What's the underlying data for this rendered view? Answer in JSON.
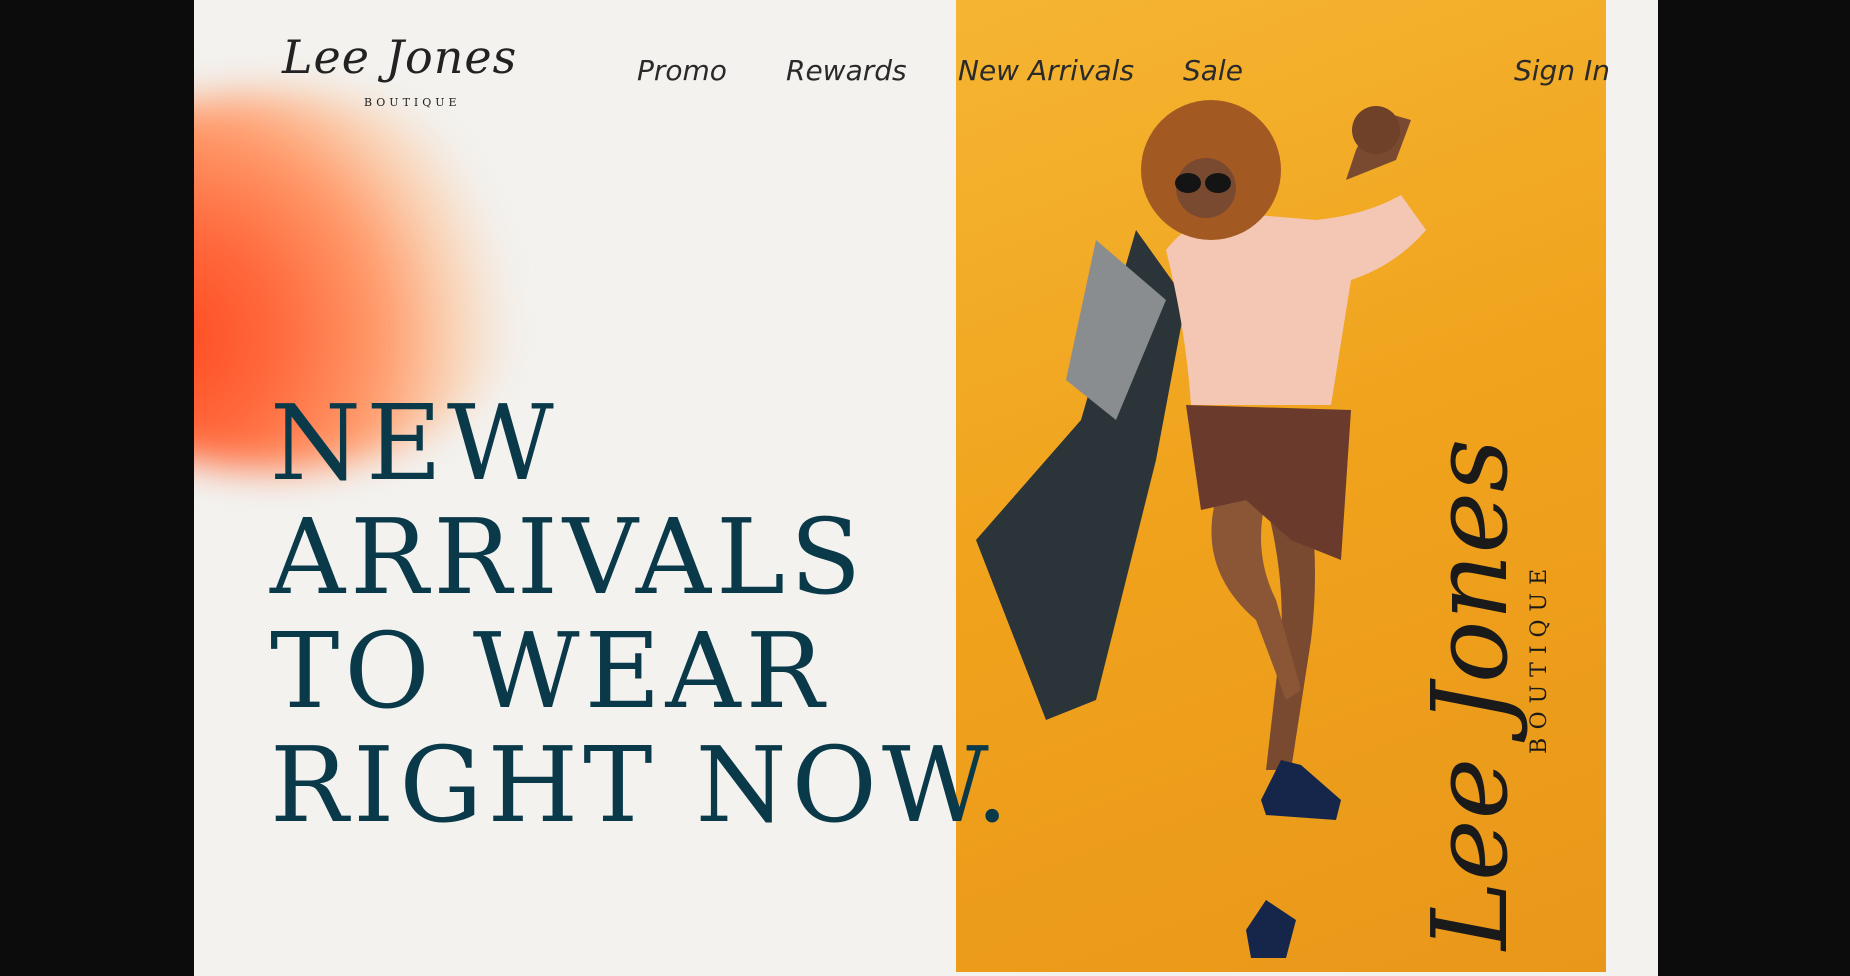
{
  "logo": {
    "script": "Lee Jones",
    "sub": "BOUTIQUE"
  },
  "nav": {
    "items": [
      "Promo",
      "Rewards",
      "New Arrivals",
      "Sale"
    ],
    "sign_in": "Sign In"
  },
  "hero": {
    "lines": [
      "NEW",
      "ARRIVALS",
      "TO WEAR",
      "RIGHT NOW."
    ]
  },
  "side_logo": {
    "script": "Lee Jones",
    "sub": "BOUTIQUE"
  },
  "colors": {
    "hero_text": "#0a3a4a",
    "photo_background": "#f0a21c",
    "page_background": "#f3f2ef",
    "blob": "#ff4a1f"
  }
}
